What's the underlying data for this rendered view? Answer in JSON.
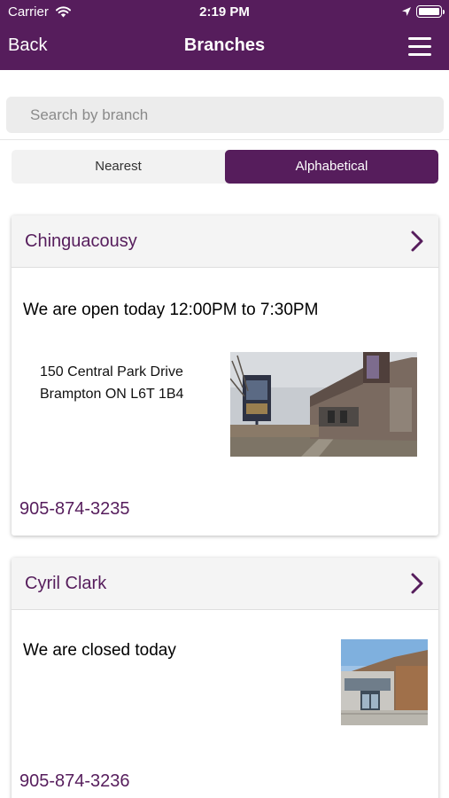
{
  "status_bar": {
    "carrier": "Carrier",
    "time": "2:19 PM"
  },
  "nav": {
    "back_label": "Back",
    "title": "Branches",
    "menu_icon": "hamburger-menu-icon"
  },
  "search": {
    "placeholder": "Search by branch",
    "value": ""
  },
  "sort_tabs": [
    {
      "label": "Nearest",
      "selected": false
    },
    {
      "label": "Alphabetical",
      "selected": true
    }
  ],
  "branches": [
    {
      "name": "Chinguacousy",
      "hours": "We are open today 12:00PM to 7:30PM",
      "address_line1": "150 Central Park Drive",
      "address_line2": "Brampton ON L6T 1B4",
      "phone": "905-874-3235"
    },
    {
      "name": "Cyril Clark",
      "hours": "We are closed today",
      "phone": "905-874-3236"
    }
  ],
  "colors": {
    "brand": "#561d5c",
    "background": "#ffffff",
    "search_field": "#ececec"
  }
}
